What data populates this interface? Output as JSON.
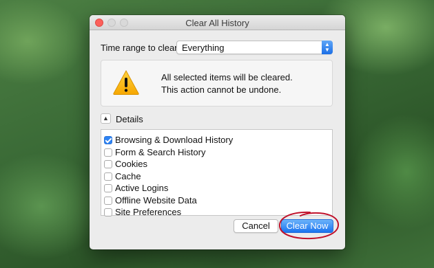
{
  "dialog": {
    "title": "Clear All History",
    "time_range": {
      "label": "Time range to clear:",
      "selected": "Everything"
    },
    "warning": {
      "icon": "warning-triangle-icon",
      "line1": "All selected items will be cleared.",
      "line2": "This action cannot be undone."
    },
    "details": {
      "label": "Details",
      "expanded": true
    },
    "items": [
      {
        "label": "Browsing & Download History",
        "checked": true
      },
      {
        "label": "Form & Search History",
        "checked": false
      },
      {
        "label": "Cookies",
        "checked": false
      },
      {
        "label": "Cache",
        "checked": false
      },
      {
        "label": "Active Logins",
        "checked": false
      },
      {
        "label": "Offline Website Data",
        "checked": false
      },
      {
        "label": "Site Preferences",
        "checked": false
      }
    ],
    "buttons": {
      "cancel": "Cancel",
      "clear_now": "Clear Now"
    }
  },
  "colors": {
    "accent": "#1a74f0",
    "annotation": "#c0102a"
  }
}
